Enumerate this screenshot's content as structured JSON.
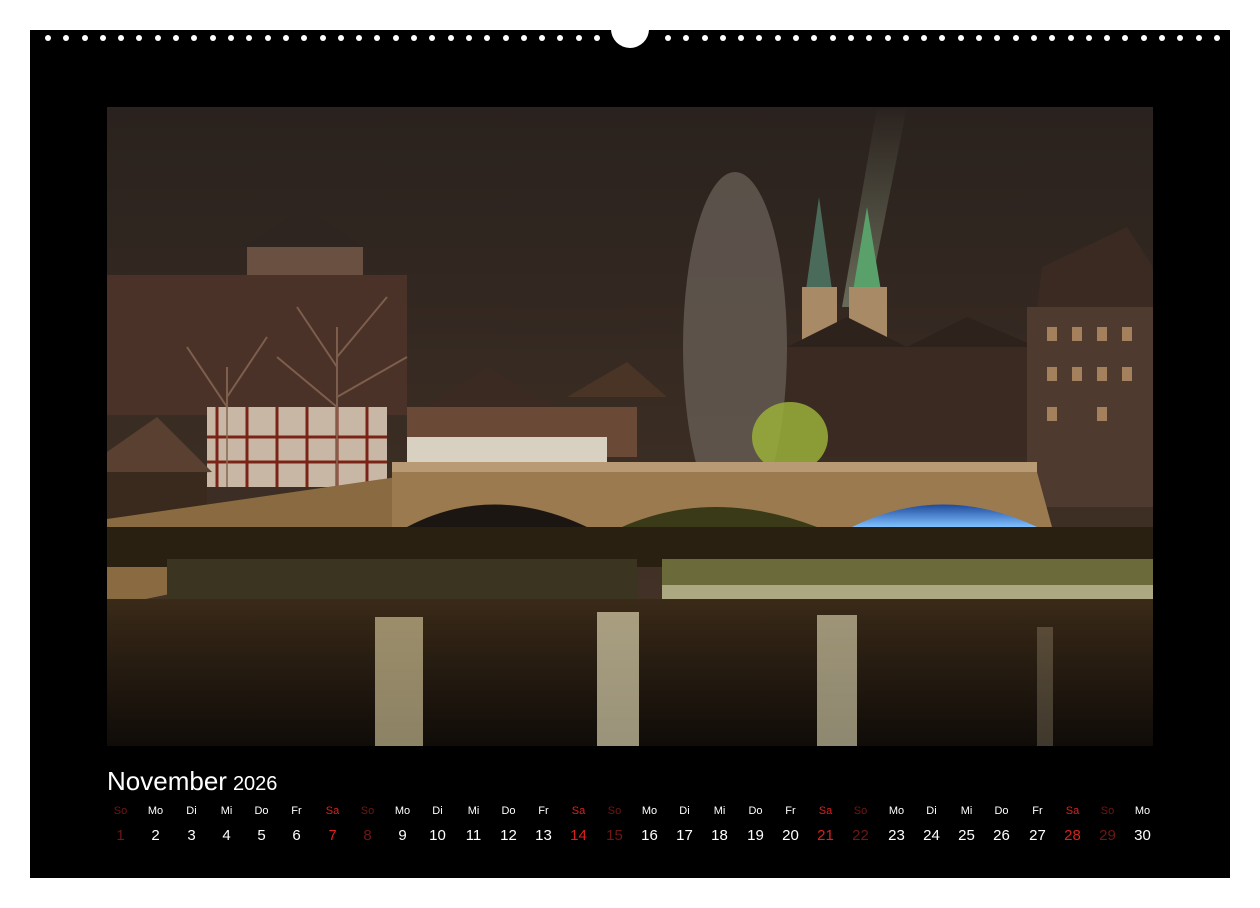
{
  "calendar": {
    "month": "November",
    "year": "2026",
    "photo_subject": "illuminated-stone-bridge-over-river-at-night",
    "days": [
      {
        "dow": "So",
        "num": "1",
        "kind": "sun"
      },
      {
        "dow": "Mo",
        "num": "2",
        "kind": "weekday"
      },
      {
        "dow": "Di",
        "num": "3",
        "kind": "weekday"
      },
      {
        "dow": "Mi",
        "num": "4",
        "kind": "weekday"
      },
      {
        "dow": "Do",
        "num": "5",
        "kind": "weekday"
      },
      {
        "dow": "Fr",
        "num": "6",
        "kind": "weekday"
      },
      {
        "dow": "Sa",
        "num": "7",
        "kind": "sat"
      },
      {
        "dow": "So",
        "num": "8",
        "kind": "sun"
      },
      {
        "dow": "Mo",
        "num": "9",
        "kind": "weekday"
      },
      {
        "dow": "Di",
        "num": "10",
        "kind": "weekday"
      },
      {
        "dow": "Mi",
        "num": "11",
        "kind": "weekday"
      },
      {
        "dow": "Do",
        "num": "12",
        "kind": "weekday"
      },
      {
        "dow": "Fr",
        "num": "13",
        "kind": "weekday"
      },
      {
        "dow": "Sa",
        "num": "14",
        "kind": "sat"
      },
      {
        "dow": "So",
        "num": "15",
        "kind": "sun"
      },
      {
        "dow": "Mo",
        "num": "16",
        "kind": "weekday"
      },
      {
        "dow": "Di",
        "num": "17",
        "kind": "weekday"
      },
      {
        "dow": "Mi",
        "num": "18",
        "kind": "weekday"
      },
      {
        "dow": "Do",
        "num": "19",
        "kind": "weekday"
      },
      {
        "dow": "Fr",
        "num": "20",
        "kind": "weekday"
      },
      {
        "dow": "Sa",
        "num": "21",
        "kind": "sat"
      },
      {
        "dow": "So",
        "num": "22",
        "kind": "sun"
      },
      {
        "dow": "Mo",
        "num": "23",
        "kind": "weekday"
      },
      {
        "dow": "Di",
        "num": "24",
        "kind": "weekday"
      },
      {
        "dow": "Mi",
        "num": "25",
        "kind": "weekday"
      },
      {
        "dow": "Do",
        "num": "26",
        "kind": "weekday"
      },
      {
        "dow": "Fr",
        "num": "27",
        "kind": "weekday"
      },
      {
        "dow": "Sa",
        "num": "28",
        "kind": "sat"
      },
      {
        "dow": "So",
        "num": "29",
        "kind": "sun"
      },
      {
        "dow": "Mo",
        "num": "30",
        "kind": "weekday"
      }
    ]
  },
  "colors": {
    "sheet_background": "#000000",
    "weekday_text": "#ffffff",
    "saturday_text": "#d9221d",
    "sunday_text": "#6e1714"
  }
}
